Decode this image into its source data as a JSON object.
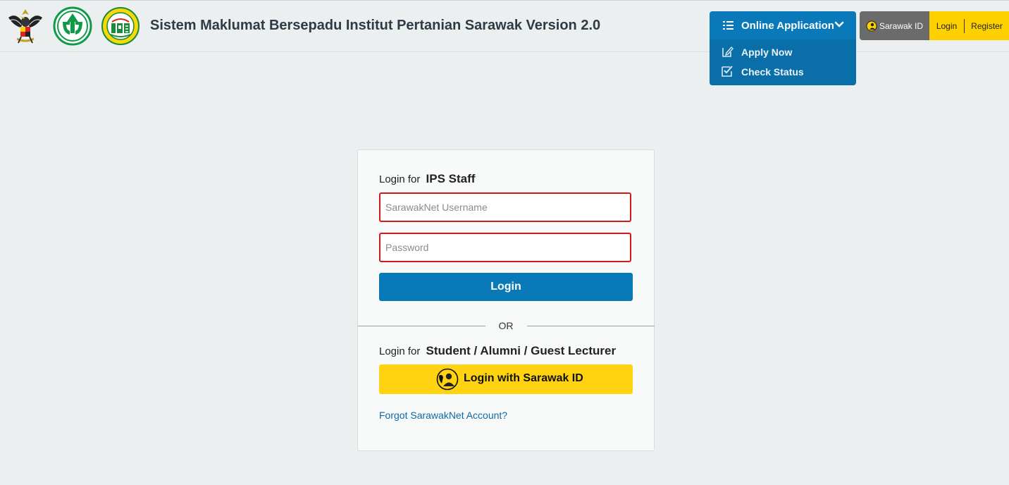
{
  "header": {
    "title": "Sistem Maklumat Bersepadu Institut Pertanian Sarawak Version 2.0",
    "logos": [
      "sarawak-crest",
      "gp-logo",
      "ips-logo"
    ]
  },
  "online_application": {
    "label": "Online Application",
    "menu": [
      {
        "label": "Apply Now",
        "icon": "edit-icon"
      },
      {
        "label": "Check Status",
        "icon": "checkbox-icon"
      }
    ]
  },
  "auth_bar": {
    "sarawak_id": "Sarawak ID",
    "login": "Login",
    "register": "Register"
  },
  "login_card": {
    "staff_prefix": "Login for",
    "staff_target": "IPS Staff",
    "username_placeholder": "SarawakNet Username",
    "password_placeholder": "Password",
    "login_button": "Login",
    "or_text": "OR",
    "student_prefix": "Login for",
    "student_target": "Student / Alumni / Guest Lecturer",
    "sarawak_login_button": "Login with Sarawak ID",
    "forgot_link": "Forgot SarawakNet Account?"
  },
  "colors": {
    "primary_blue": "#0a79b8",
    "dropdown_blue": "#0a6ea8",
    "yellow": "#ffd30f",
    "error_red": "#d31a1a",
    "link_blue": "#0b6aa6",
    "background": "#ebeff0"
  }
}
